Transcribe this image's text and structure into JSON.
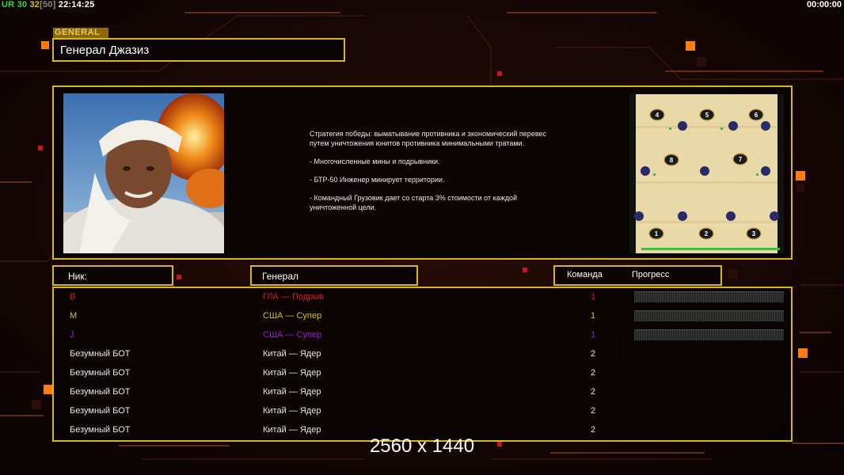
{
  "hud": {
    "ur_label": "UR",
    "ur_value": "30",
    "fps": "32",
    "fps_limit": "[50]",
    "clock": "22:14:25",
    "timer": "00:00:00"
  },
  "general": {
    "tag": "GENERAL",
    "name": "Генерал Джазиз",
    "strategy": [
      "Стратегия победы: выматывание противника и экономический перевес путем уничтожения юнитов противника минимальными тратами.",
      "- Многочисленные мины и подрывники.",
      "- БТР-50 Инженер минирует территории.",
      "- Командный Грузовик дает со старта 3% стоимости от каждой уничтоженной цели."
    ]
  },
  "map": {
    "spawns": [
      "4",
      "5",
      "6",
      "8",
      "7",
      "1",
      "2",
      "3"
    ]
  },
  "table": {
    "col_name": "Ник:",
    "col_general": "Генерал",
    "col_team": "Команда",
    "col_progress": "Прогресс",
    "rows": [
      {
        "name": "B",
        "general": "ГЛА — Подрыв",
        "team": "1",
        "color": "#e01a1a",
        "progress": 0
      },
      {
        "name": "M",
        "general": "США — Супер",
        "team": "1",
        "color": "#d6c21a",
        "progress": 0
      },
      {
        "name": "J",
        "general": "США — Супер",
        "team": "1",
        "color": "#9a1fd0",
        "progress": 0
      },
      {
        "name": "Безумный БОТ",
        "general": "Китай — Ядер",
        "team": "2",
        "color": "#e8e8e8"
      },
      {
        "name": "Безумный БОТ",
        "general": "Китай — Ядер",
        "team": "2",
        "color": "#e8e8e8"
      },
      {
        "name": "Безумный БОТ",
        "general": "Китай — Ядер",
        "team": "2",
        "color": "#e8e8e8"
      },
      {
        "name": "Безумный БОТ",
        "general": "Китай — Ядер",
        "team": "2",
        "color": "#e8e8e8"
      },
      {
        "name": "Безумный БОТ",
        "general": "Китай — Ядер",
        "team": "2",
        "color": "#e8e8e8"
      }
    ]
  },
  "overlay": {
    "resolution": "2560 x 1440"
  },
  "colors": {
    "accent": "#d8b51c",
    "ur": "#3ad64a",
    "fps": "#e0c21a",
    "orange": "#ff7a10"
  }
}
